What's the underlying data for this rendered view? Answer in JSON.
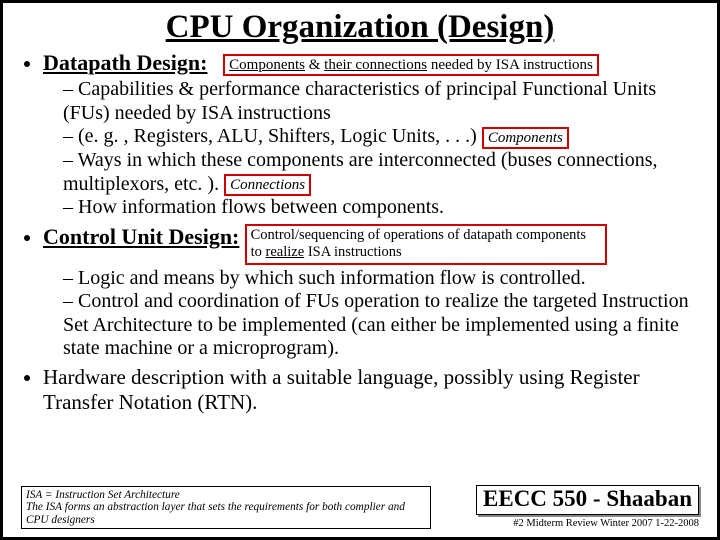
{
  "title": "CPU Organization (Design)",
  "datapath": {
    "header": "Datapath Design:",
    "box_html": "<span class='u'>Components</span> &amp; <span class='u'>their connections</span> needed by ISA instructions",
    "items": {
      "a": "Capabilities & performance characteristics of principal Functional Units (FUs) needed by ISA instructions",
      "b_text": "(e. g. , Registers, ALU, Shifters, Logic Units, . . .) ",
      "b_box": "Components",
      "c_text": "Ways in which these components are interconnected (buses connections, multiplexors, etc. ). ",
      "c_box": "Connections",
      "d": "How information flows between components."
    }
  },
  "control": {
    "header": "Control Unit Design:",
    "box_html": "Control/sequencing of operations of datapath components to <span class='u'>realize</span> ISA instructions",
    "items": {
      "a": "Logic and means by which such information flow is controlled.",
      "b": "Control and coordination of FUs operation to realize the targeted Instruction Set Architecture to be implemented (can either be implemented using a finite state machine or a microprogram)."
    }
  },
  "hw": "Hardware description with a suitable language, possibly using Register Transfer Notation  (RTN).",
  "footnote": {
    "l1": "ISA = Instruction Set Architecture",
    "l2": "The ISA forms an abstraction layer that sets the requirements for both complier and CPU designers"
  },
  "course": "EECC 550 - Shaaban",
  "page": "#2   Midterm Review   Winter 2007  1-22-2008"
}
